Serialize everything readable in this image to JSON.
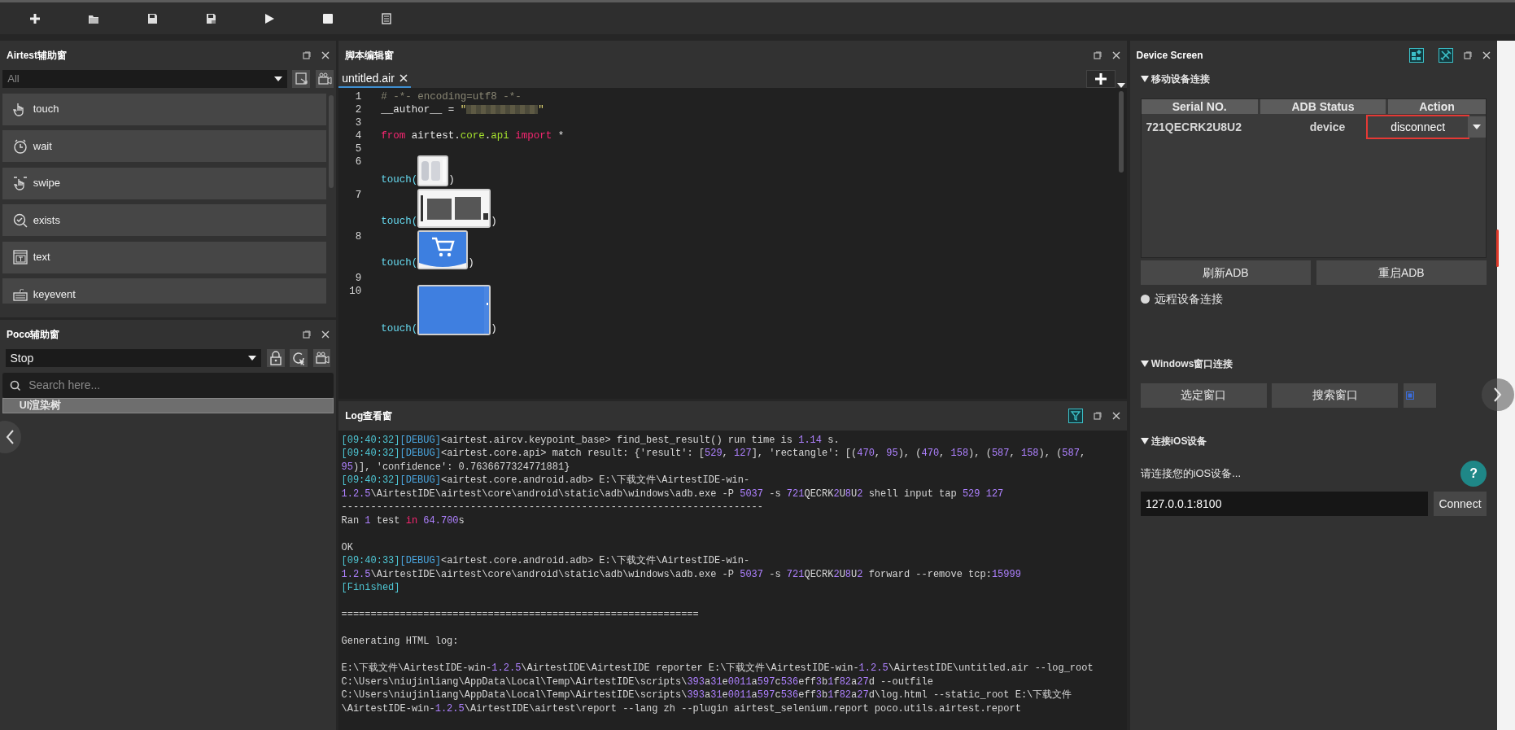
{
  "toolbar": {
    "buttons": [
      {
        "kind": "new"
      },
      {
        "kind": "open"
      },
      {
        "kind": "save"
      },
      {
        "kind": "save_as"
      },
      {
        "kind": "run"
      },
      {
        "kind": "stop"
      },
      {
        "kind": "log"
      }
    ]
  },
  "airtest_panel": {
    "title": "Airtest辅助窗",
    "filter": {
      "value": "All"
    },
    "actions": [
      {
        "kind": "touch",
        "label": "touch"
      },
      {
        "kind": "wait",
        "label": "wait"
      },
      {
        "kind": "swipe",
        "label": "swipe"
      },
      {
        "kind": "exists",
        "label": "exists"
      },
      {
        "kind": "text",
        "label": "text"
      },
      {
        "kind": "keyevent",
        "label": "keyevent"
      }
    ]
  },
  "poco_panel": {
    "title": "Poco辅助窗",
    "mode": {
      "value": "Stop"
    },
    "search": {
      "placeholder": "Search here..."
    },
    "tree": [
      {
        "label": "UI渲染树",
        "selected": true
      }
    ]
  },
  "editor": {
    "title": "脚本编辑窗",
    "tabs": [
      {
        "label": "untitled.air",
        "selected": true
      }
    ],
    "lines": [
      {
        "number": "1",
        "tokens": [
          {
            "kind": "comment",
            "text": "# -*- encoding=utf8 -*-"
          }
        ]
      },
      {
        "number": "2",
        "tokens": [
          {
            "kind": "plain",
            "text": "__author__ = "
          },
          {
            "kind": "str",
            "text": "\""
          },
          {
            "kind": "redacted"
          },
          {
            "kind": "str",
            "text": "\""
          }
        ]
      },
      {
        "number": "3"
      },
      {
        "number": "4",
        "tokens": [
          {
            "kind": "kw",
            "text": "from"
          },
          {
            "kind": "plain",
            "text": " airtest."
          },
          {
            "kind": "module",
            "text": "core"
          },
          {
            "kind": "plain",
            "text": "."
          },
          {
            "kind": "module",
            "text": "api "
          },
          {
            "kind": "kw",
            "text": "import"
          },
          {
            "kind": "plain",
            "text": " *"
          }
        ]
      },
      {
        "number": "5"
      },
      {
        "number": "6",
        "call": "touch(",
        "close": ")",
        "image": {
          "kind": "light"
        }
      },
      {
        "number": "7",
        "call": "touch(",
        "close": ")",
        "image": {
          "kind": "label"
        }
      },
      {
        "number": "8",
        "call": "touch(",
        "close": ")",
        "image": {
          "kind": "cart"
        }
      },
      {
        "number": "9"
      },
      {
        "number": "10",
        "call": "touch(",
        "close": ")",
        "image": {
          "kind": "blue"
        }
      }
    ]
  },
  "log": {
    "title": "Log查看窗",
    "lines": [
      {
        "segments": [
          {
            "kind": "ts",
            "text": "[09:40:32]"
          },
          {
            "kind": "lvl",
            "text": "[DEBUG]"
          },
          {
            "kind": "plain",
            "text": "<airtest.aircv.keypoint_base> find_best_result() run time is "
          },
          {
            "kind": "num",
            "text": "1.14"
          },
          {
            "kind": "plain",
            "text": " s."
          }
        ]
      },
      {
        "segments": [
          {
            "kind": "ts",
            "text": "[09:40:32]"
          },
          {
            "kind": "lvl",
            "text": "[DEBUG]"
          },
          {
            "kind": "plain",
            "text": "<airtest.core.api> match result: {'result': ["
          },
          {
            "kind": "num",
            "text": "529"
          },
          {
            "kind": "plain",
            "text": ", "
          },
          {
            "kind": "num",
            "text": "127"
          },
          {
            "kind": "plain",
            "text": "], 'rectangle': [("
          },
          {
            "kind": "num",
            "text": "470"
          },
          {
            "kind": "plain",
            "text": ", "
          },
          {
            "kind": "num",
            "text": "95"
          },
          {
            "kind": "plain",
            "text": "), ("
          },
          {
            "kind": "num",
            "text": "470"
          },
          {
            "kind": "plain",
            "text": ", "
          },
          {
            "kind": "num",
            "text": "158"
          },
          {
            "kind": "plain",
            "text": "), ("
          },
          {
            "kind": "num",
            "text": "587"
          },
          {
            "kind": "plain",
            "text": ", "
          },
          {
            "kind": "num",
            "text": "158"
          },
          {
            "kind": "plain",
            "text": "), ("
          },
          {
            "kind": "num",
            "text": "587"
          },
          {
            "kind": "plain",
            "text": ","
          }
        ]
      },
      {
        "segments": [
          {
            "kind": "num",
            "text": "95"
          },
          {
            "kind": "plain",
            "text": ")], 'confidence': 0.7636677324771881}"
          }
        ]
      },
      {
        "segments": [
          {
            "kind": "ts",
            "text": "[09:40:32]"
          },
          {
            "kind": "lvl",
            "text": "[DEBUG]"
          },
          {
            "kind": "plain",
            "text": "<airtest.core.android.adb> E:\\下载文件\\AirtestIDE-win-"
          }
        ]
      },
      {
        "segments": [
          {
            "kind": "num",
            "text": "1.2.5"
          },
          {
            "kind": "plain",
            "text": "\\AirtestIDE\\airtest\\core\\android\\static\\adb\\windows\\adb.exe -P "
          },
          {
            "kind": "num",
            "text": "5037"
          },
          {
            "kind": "plain",
            "text": " -s "
          },
          {
            "kind": "num",
            "text": "721"
          },
          {
            "kind": "plain",
            "text": "QECRK"
          },
          {
            "kind": "num",
            "text": "2"
          },
          {
            "kind": "plain",
            "text": "U"
          },
          {
            "kind": "num",
            "text": "8"
          },
          {
            "kind": "plain",
            "text": "U"
          },
          {
            "kind": "num",
            "text": "2"
          },
          {
            "kind": "plain",
            "text": " shell input tap "
          },
          {
            "kind": "num",
            "text": "529 "
          },
          {
            "kind": "num",
            "text": "127"
          }
        ]
      },
      {
        "segments": [
          {
            "kind": "plain",
            "text": "------------------------------------------------------------------------"
          }
        ]
      },
      {
        "segments": [
          {
            "kind": "plain",
            "text": "Ran "
          },
          {
            "kind": "num",
            "text": "1"
          },
          {
            "kind": "plain",
            "text": " test "
          },
          {
            "kind": "kw",
            "text": "in "
          },
          {
            "kind": "num",
            "text": "64.700"
          },
          {
            "kind": "plain",
            "text": "s"
          }
        ]
      },
      {
        "kind": "blank"
      },
      {
        "segments": [
          {
            "kind": "plain",
            "text": "OK"
          }
        ]
      },
      {
        "segments": [
          {
            "kind": "ts",
            "text": "[09:40:33]"
          },
          {
            "kind": "lvl",
            "text": "[DEBUG]"
          },
          {
            "kind": "plain",
            "text": "<airtest.core.android.adb> E:\\下载文件\\AirtestIDE-win-"
          }
        ]
      },
      {
        "segments": [
          {
            "kind": "num",
            "text": "1.2.5"
          },
          {
            "kind": "plain",
            "text": "\\AirtestIDE\\airtest\\core\\android\\static\\adb\\windows\\adb.exe -P "
          },
          {
            "kind": "num",
            "text": "5037"
          },
          {
            "kind": "plain",
            "text": " -s "
          },
          {
            "kind": "num",
            "text": "721"
          },
          {
            "kind": "plain",
            "text": "QECRK"
          },
          {
            "kind": "num",
            "text": "2"
          },
          {
            "kind": "plain",
            "text": "U"
          },
          {
            "kind": "num",
            "text": "8"
          },
          {
            "kind": "plain",
            "text": "U"
          },
          {
            "kind": "num",
            "text": "2"
          },
          {
            "kind": "plain",
            "text": " forward --remove tcp:"
          },
          {
            "kind": "num",
            "text": "15999"
          }
        ]
      },
      {
        "segments": [
          {
            "kind": "ts",
            "text": "[Finished]"
          }
        ]
      },
      {
        "kind": "blank"
      },
      {
        "segments": [
          {
            "kind": "plain",
            "text": "============================================================="
          }
        ]
      },
      {
        "kind": "blank"
      },
      {
        "segments": [
          {
            "kind": "plain",
            "text": "Generating HTML log:"
          }
        ]
      },
      {
        "kind": "blank"
      },
      {
        "segments": [
          {
            "kind": "plain",
            "text": "E:\\下载文件\\AirtestIDE-win-"
          },
          {
            "kind": "num",
            "text": "1.2.5"
          },
          {
            "kind": "plain",
            "text": "\\AirtestIDE\\AirtestIDE reporter E:\\下载文件\\AirtestIDE-win-"
          },
          {
            "kind": "num",
            "text": "1.2.5"
          },
          {
            "kind": "plain",
            "text": "\\AirtestIDE\\untitled.air --log_root"
          }
        ]
      },
      {
        "segments": [
          {
            "kind": "plain",
            "text": "C:\\Users\\niujinliang\\AppData\\Local\\Temp\\AirtestIDE\\scripts\\"
          },
          {
            "kind": "num",
            "text": "393"
          },
          {
            "kind": "plain",
            "text": "a"
          },
          {
            "kind": "num",
            "text": "31"
          },
          {
            "kind": "plain",
            "text": "e"
          },
          {
            "kind": "num",
            "text": "0011"
          },
          {
            "kind": "plain",
            "text": "a"
          },
          {
            "kind": "num",
            "text": "597"
          },
          {
            "kind": "plain",
            "text": "c"
          },
          {
            "kind": "num",
            "text": "536"
          },
          {
            "kind": "plain",
            "text": "eff"
          },
          {
            "kind": "num",
            "text": "3"
          },
          {
            "kind": "plain",
            "text": "b"
          },
          {
            "kind": "num",
            "text": "1"
          },
          {
            "kind": "plain",
            "text": "f"
          },
          {
            "kind": "num",
            "text": "82"
          },
          {
            "kind": "plain",
            "text": "a"
          },
          {
            "kind": "num",
            "text": "27"
          },
          {
            "kind": "plain",
            "text": "d --outfile"
          }
        ]
      },
      {
        "segments": [
          {
            "kind": "plain",
            "text": "C:\\Users\\niujinliang\\AppData\\Local\\Temp\\AirtestIDE\\scripts\\"
          },
          {
            "kind": "num",
            "text": "393"
          },
          {
            "kind": "plain",
            "text": "a"
          },
          {
            "kind": "num",
            "text": "31"
          },
          {
            "kind": "plain",
            "text": "e"
          },
          {
            "kind": "num",
            "text": "0011"
          },
          {
            "kind": "plain",
            "text": "a"
          },
          {
            "kind": "num",
            "text": "597"
          },
          {
            "kind": "plain",
            "text": "c"
          },
          {
            "kind": "num",
            "text": "536"
          },
          {
            "kind": "plain",
            "text": "eff"
          },
          {
            "kind": "num",
            "text": "3"
          },
          {
            "kind": "plain",
            "text": "b"
          },
          {
            "kind": "num",
            "text": "1"
          },
          {
            "kind": "plain",
            "text": "f"
          },
          {
            "kind": "num",
            "text": "82"
          },
          {
            "kind": "plain",
            "text": "a"
          },
          {
            "kind": "num",
            "text": "27"
          },
          {
            "kind": "plain",
            "text": "d\\log.html --static_root E:\\下载文件"
          }
        ]
      },
      {
        "segments": [
          {
            "kind": "plain",
            "text": "\\AirtestIDE-win-"
          },
          {
            "kind": "num",
            "text": "1.2.5"
          },
          {
            "kind": "plain",
            "text": "\\AirtestIDE\\airtest\\report --lang zh --plugin airtest_selenium.report poco.utils.airtest.report"
          }
        ]
      }
    ]
  },
  "device_panel": {
    "title": "Device Screen",
    "mobile": {
      "heading": "移动设备连接",
      "expanded": true,
      "columns": [
        "Serial NO.",
        "ADB Status",
        "Action"
      ],
      "rows": [
        {
          "serial": "721QECRK2U8U2",
          "status": "device",
          "action": "disconnect",
          "annotated": true
        }
      ],
      "buttons": [
        "刷新ADB",
        "重启ADB"
      ],
      "remote": {
        "label": "远程设备连接",
        "selected": false
      }
    },
    "windows": {
      "heading": "Windows窗口连接",
      "expanded": true,
      "buttons": [
        "选定窗口",
        "搜索窗口"
      ]
    },
    "ios": {
      "heading": "连接iOS设备",
      "expanded": true,
      "hint": "请连接您的iOS设备...",
      "help": "?",
      "address": {
        "value": "127.0.0.1:8100"
      },
      "button": "Connect"
    }
  }
}
